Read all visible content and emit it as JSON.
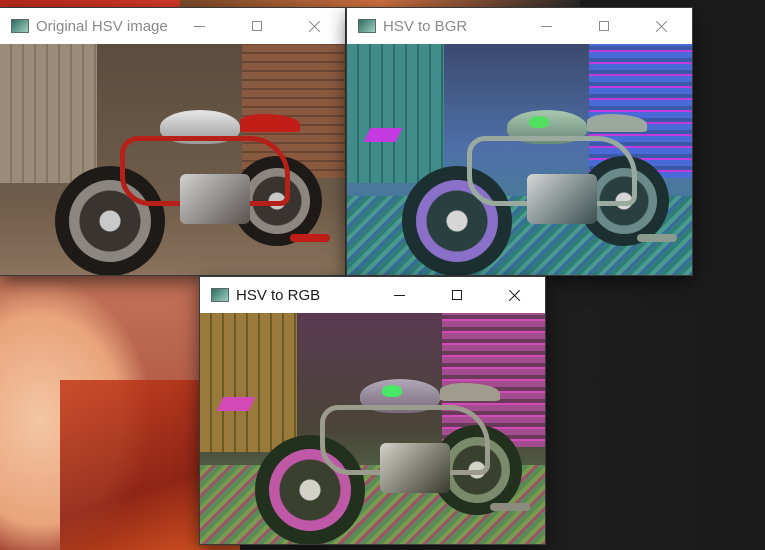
{
  "windows": [
    {
      "id": "original",
      "title": "Original HSV image",
      "active": false,
      "image_alt": "motorcycle in workshop (original colors)"
    },
    {
      "id": "bgr",
      "title": "HSV to BGR",
      "active": false,
      "image_alt": "motorcycle in workshop (HSV to BGR converted colors)"
    },
    {
      "id": "rgb",
      "title": "HSV to RGB",
      "active": true,
      "image_alt": "motorcycle in workshop (HSV to RGB converted colors)"
    }
  ],
  "icons": {
    "app": "image-window-icon",
    "minimize": "minimize-icon",
    "maximize": "maximize-icon",
    "close": "close-icon"
  },
  "palette": {
    "original": {
      "wall": "#6b5a48",
      "floor": "#7a6450",
      "bike": "#b62018",
      "chrome": "#c9c9c9",
      "dark": "#2a2622",
      "door": "#9a8c78"
    },
    "bgr": {
      "wall": "#4f6fa8",
      "floor": "#3d8a86",
      "bike": "#8a9a8e",
      "chrome": "#d6d6d6",
      "dark": "#1c3032",
      "door": "#3f8c8a",
      "accent": "#c23ae0",
      "accent2": "#4fe060"
    },
    "rgb": {
      "wall": "#a24e8e",
      "floor": "#5a8a56",
      "bike": "#8c8c7e",
      "chrome": "#d2d2c8",
      "dark": "#22301e",
      "door": "#9a7a3a",
      "accent": "#d44ab8",
      "accent2": "#46e866"
    }
  }
}
